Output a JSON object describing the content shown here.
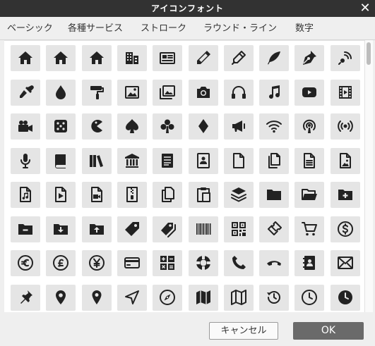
{
  "dialog": {
    "title": "アイコンフォント",
    "close_icon": "close-icon"
  },
  "tabs": [
    {
      "label": "ベーシック"
    },
    {
      "label": "各種サービス"
    },
    {
      "label": "ストローク"
    },
    {
      "label": "ラウンド・ライン"
    },
    {
      "label": "数字"
    }
  ],
  "icon_rows": [
    [
      "home-icon",
      "home-icon",
      "home-icon",
      "building-icon",
      "newspaper-icon",
      "pencil-icon",
      "pen-icon",
      "feather-icon",
      "pen-nib-icon",
      "blog-icon"
    ],
    [
      "eyedropper-icon",
      "droplet-icon",
      "paint-roller-icon",
      "image-icon",
      "images-icon",
      "camera-icon",
      "headphones-icon",
      "music-note-icon",
      "play-button-icon",
      "film-icon"
    ],
    [
      "video-camera-icon",
      "dice-icon",
      "pacman-icon",
      "spade-icon",
      "club-icon",
      "diamond-icon",
      "megaphone-icon",
      "wifi-icon",
      "podcast-icon",
      "broadcast-icon"
    ],
    [
      "microphone-icon",
      "book-icon",
      "books-icon",
      "library-icon",
      "document-text-icon",
      "profile-card-icon",
      "file-icon",
      "files-icon",
      "file-text-icon",
      "file-image-icon"
    ],
    [
      "file-music-icon",
      "file-play-icon",
      "file-video-icon",
      "file-zip-icon",
      "copy-icon",
      "paste-icon",
      "layers-icon",
      "folder-icon",
      "folder-open-icon",
      "folder-plus-icon"
    ],
    [
      "folder-minus-icon",
      "folder-download-icon",
      "folder-upload-icon",
      "tag-icon",
      "tags-icon",
      "barcode-icon",
      "qrcode-icon",
      "ticket-icon",
      "cart-icon",
      "coin-dollar-icon"
    ],
    [
      "coin-euro-icon",
      "coin-pound-icon",
      "coin-yen-icon",
      "credit-card-icon",
      "calculator-icon",
      "lifebuoy-icon",
      "phone-icon",
      "phone-hang-up-icon",
      "address-book-icon",
      "envelope-icon"
    ],
    [
      "pushpin-icon",
      "location-icon",
      "location-2-icon",
      "compass-icon",
      "compass-2-icon",
      "map-icon",
      "map-2-icon",
      "history-icon",
      "clock-icon",
      "clock-2-icon"
    ]
  ],
  "footer": {
    "cancel_label": "キャンセル",
    "ok_label": "OK"
  },
  "colors": {
    "titlebar": "#323232",
    "icon": "#222222",
    "cell": "#e5e5e5",
    "ok_button": "#6a6a6a"
  }
}
